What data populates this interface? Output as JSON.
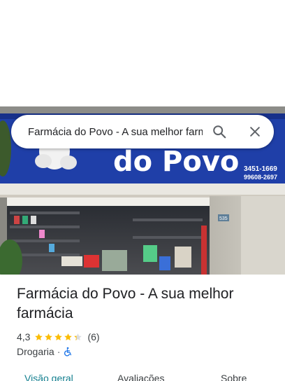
{
  "search": {
    "query": "Farmácia do Povo - A sua melhor farmácia"
  },
  "photo": {
    "sign_text": "do Povo",
    "phone_1": "3451-1669",
    "phone_2": "99608-2697",
    "street_number": "535"
  },
  "place": {
    "title": "Farmácia do Povo - A sua melhor farmácia",
    "rating": "4,3",
    "rating_value": 4.3,
    "star_count": 5,
    "review_count": "(6)",
    "category": "Drogaria",
    "separator": "·",
    "accessibility_icon": "wheelchair-icon"
  },
  "tabs": [
    {
      "label": "Visão geral",
      "active": true
    },
    {
      "label": "Avaliações",
      "active": false
    },
    {
      "label": "Sobre",
      "active": false
    }
  ],
  "colors": {
    "star": "#fbbc04",
    "star_empty": "#dadce0",
    "accessibility": "#1a73e8",
    "tab_active": "#137f8f",
    "sign_blue": "#1f3fa8"
  }
}
